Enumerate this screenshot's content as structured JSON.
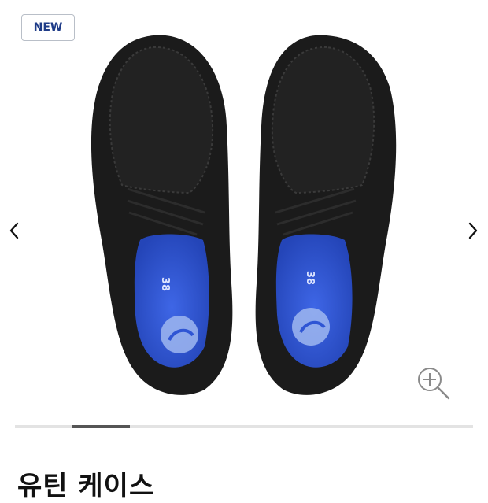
{
  "badge": {
    "label": "NEW"
  },
  "gallery": {
    "prev_icon": "chevron-left-icon",
    "next_icon": "chevron-right-icon",
    "zoom_icon": "zoom-in-icon",
    "image_alt": "black shoes top view",
    "insole_size_text": "38"
  },
  "carousel": {
    "slide_index": 2,
    "slide_count": 8
  },
  "product": {
    "title": "유틴 케이스"
  },
  "colors": {
    "badge_text": "#1f3c88",
    "insole": "#2f55d4",
    "shoe": "#1b1b1b"
  }
}
